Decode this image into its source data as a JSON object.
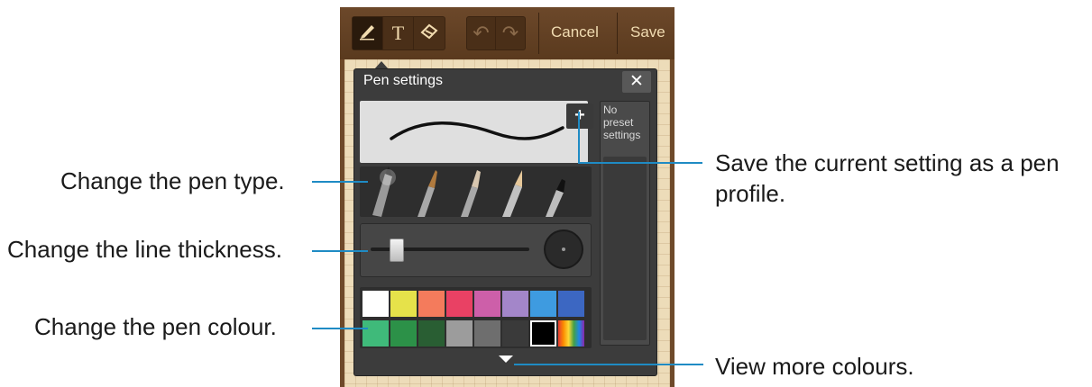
{
  "toolbar": {
    "tools": [
      {
        "name": "pen-tool-button",
        "icon": "pen-icon",
        "glyph": "✎",
        "active": true
      },
      {
        "name": "text-tool-button",
        "icon": "text-icon",
        "glyph": "T",
        "active": false
      },
      {
        "name": "eraser-tool-button",
        "icon": "eraser-icon",
        "glyph": "⌫",
        "active": false
      }
    ],
    "history": [
      {
        "name": "undo-button",
        "icon": "undo-icon",
        "glyph": "↶"
      },
      {
        "name": "redo-button",
        "icon": "redo-icon",
        "glyph": "↷"
      }
    ],
    "cancel_label": "Cancel",
    "save_label": "Save"
  },
  "pen_settings": {
    "title": "Pen settings",
    "close_icon": "close-icon",
    "add_preset_icon": "plus-icon",
    "preset_text": "No preset settings",
    "pen_types": [
      "pen",
      "brush",
      "calligraphy",
      "pencil",
      "marker"
    ],
    "thickness_level": 0.12,
    "colors": [
      "#ffffff",
      "#e6e24a",
      "#f47b5c",
      "#e94164",
      "#cd5fa9",
      "#a386c9",
      "#3e9be0",
      "#3c67c2",
      "#3fba7a",
      "#2c9148",
      "#295e33",
      "#9c9c9c",
      "#6e6e6e",
      "#3a3a3a",
      "#000000",
      "rainbow"
    ],
    "selected_color": "#000000",
    "more_icon": "triangle-down-icon"
  },
  "annotations": {
    "pen_type": "Change the pen type.",
    "thickness": "Change the line thickness.",
    "colour": "Change the pen colour.",
    "save_line1": "Save the current setting as a pen",
    "save_line2": "profile.",
    "more_colours": "View more colours."
  },
  "accent_color": "#1f8bc4"
}
